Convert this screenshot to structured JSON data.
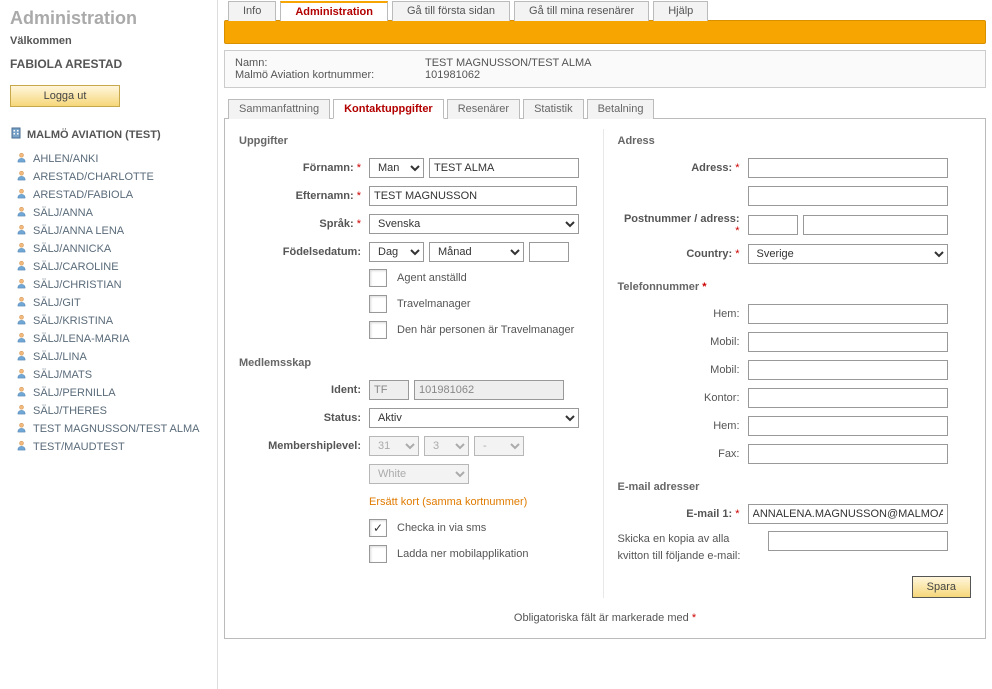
{
  "sidebar": {
    "title": "Administration",
    "welcome": "Välkommen",
    "username": "FABIOLA  ARESTAD",
    "logout": "Logga ut",
    "org": "MALMÖ AVIATION (TEST)",
    "users": [
      "AHLEN/ANKI",
      "ARESTAD/CHARLOTTE",
      "ARESTAD/FABIOLA",
      "SÄLJ/ANNA",
      "SÄLJ/ANNA LENA",
      "SÄLJ/ANNICKA",
      "SÄLJ/CAROLINE",
      "SÄLJ/CHRISTIAN",
      "SÄLJ/GIT",
      "SÄLJ/KRISTINA",
      "SÄLJ/LENA-MARIA",
      "SÄLJ/LINA",
      "SÄLJ/MATS",
      "SÄLJ/PERNILLA",
      "SÄLJ/THERES",
      "TEST MAGNUSSON/TEST ALMA",
      "TEST/MAUDTEST"
    ]
  },
  "topnav": {
    "tabs": [
      "Info",
      "Administration",
      "Gå till första sidan",
      "Gå till mina resenärer",
      "Hjälp"
    ],
    "active_index": 1
  },
  "infobox": {
    "name_label": "Namn:",
    "name_value": "TEST MAGNUSSON/TEST ALMA",
    "card_label": "Malmö Aviation kortnummer:",
    "card_value": "101981062"
  },
  "subtabs": {
    "tabs": [
      "Sammanfattning",
      "Kontaktuppgifter",
      "Resenärer",
      "Statistik",
      "Betalning"
    ],
    "active_index": 1
  },
  "uppgifter": {
    "heading": "Uppgifter",
    "fornamn_label": "Förnamn:",
    "title_select": "Man",
    "fornamn_value": "TEST ALMA",
    "efternamn_label": "Efternamn:",
    "efternamn_value": "TEST MAGNUSSON",
    "sprak_label": "Språk:",
    "sprak_value": "Svenska",
    "dob_label": "Födelsedatum:",
    "dob_day": "Dag",
    "dob_month": "Månad",
    "dob_year": "",
    "cb_agent": "Agent anställd",
    "cb_travelmanager": "Travelmanager",
    "cb_person_tm": "Den här personen är Travelmanager"
  },
  "medlemsskap": {
    "heading": "Medlemsskap",
    "ident_label": "Ident:",
    "ident_prefix": "TF",
    "ident_number": "101981062",
    "status_label": "Status:",
    "status_value": "Aktiv",
    "level_label": "Membershiplevel:",
    "level_a": "31",
    "level_b": "3",
    "level_c": "-",
    "color": "White",
    "replace_link": "Ersätt kort (samma kortnummer)",
    "cb_sms": "Checka in via sms",
    "cb_sms_checked": true,
    "cb_app": "Ladda ner mobilapplikation"
  },
  "adress": {
    "heading": "Adress",
    "adress_label": "Adress:",
    "post_label": "Postnummer / adress:",
    "country_label": "Country:",
    "country_value": "Sverige"
  },
  "telefon": {
    "heading": "Telefonnummer",
    "labels": [
      "Hem:",
      "Mobil:",
      "Mobil:",
      "Kontor:",
      "Hem:",
      "Fax:"
    ]
  },
  "email": {
    "heading": "E-mail adresser",
    "email1_label": "E-mail 1:",
    "email1_value": "ANNALENA.MAGNUSSON@MALMOAVI",
    "copy_label": "Skicka en kopia av alla kvitton till följande e-mail:"
  },
  "footer": {
    "required_note": "Obligatoriska fält är markerade med ",
    "save": "Spara"
  }
}
